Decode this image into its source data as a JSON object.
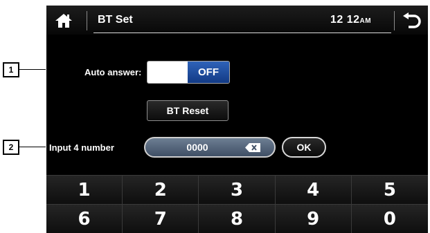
{
  "header": {
    "title": "BT Set",
    "time": "12 12",
    "ampm": "AM"
  },
  "auto_answer": {
    "label": "Auto answer:",
    "state": "OFF"
  },
  "bt_reset": {
    "label": "BT Reset"
  },
  "pin": {
    "label": "Input 4 number",
    "value": "0000",
    "ok_label": "OK"
  },
  "keypad": {
    "keys": [
      "1",
      "2",
      "3",
      "4",
      "5",
      "6",
      "7",
      "8",
      "9",
      "0"
    ]
  },
  "callouts": [
    "1",
    "2"
  ],
  "icons": {
    "home": "home-icon",
    "back": "back-arrow-icon",
    "backspace": "backspace-icon"
  },
  "colors": {
    "toggle_off": "#1f4fa3",
    "background": "#000000"
  }
}
